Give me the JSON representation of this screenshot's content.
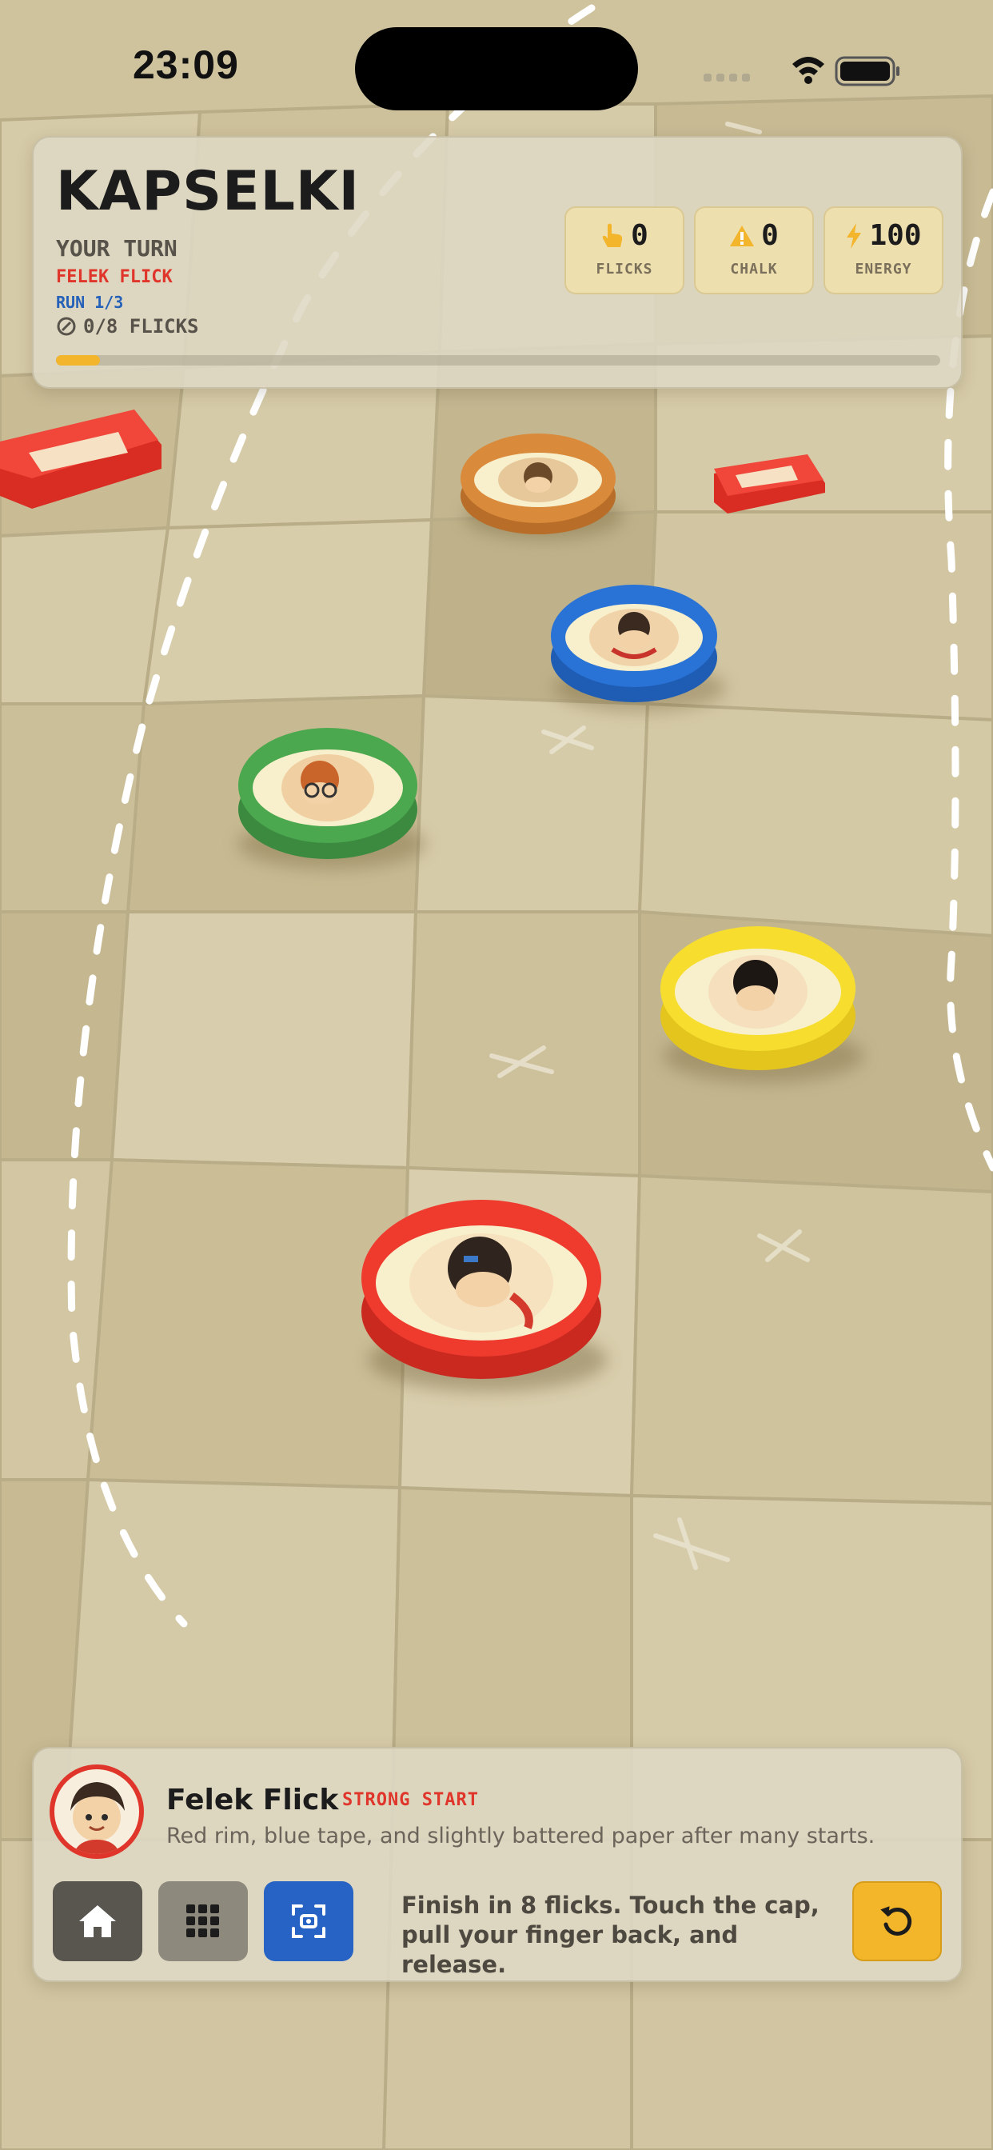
{
  "status_bar": {
    "time": "23:09"
  },
  "hud": {
    "title": "KAPSELKI",
    "turn_label": "YOUR TURN",
    "player_name": "FELEK FLICK",
    "run": "RUN 1/3",
    "flicks_progress_text": "0/8 FLICKS",
    "progress_fraction": 0.05,
    "stats": [
      {
        "value": "0",
        "label": "FLICKS",
        "icon": "pointer-hand-icon",
        "color": "#f2b52c"
      },
      {
        "value": "0",
        "label": "CHALK",
        "icon": "warning-icon",
        "color": "#f2b52c"
      },
      {
        "value": "100",
        "label": "ENERGY",
        "icon": "lightning-icon",
        "color": "#f2b52c"
      }
    ]
  },
  "board": {
    "caps": [
      {
        "name": "orange-cap",
        "color": "#d98a3a"
      },
      {
        "name": "blue-cap",
        "color": "#2a73d6"
      },
      {
        "name": "green-cap",
        "color": "#4ca84f"
      },
      {
        "name": "yellow-cap",
        "color": "#f7de2e"
      },
      {
        "name": "red-cap",
        "color": "#ef3a2e"
      }
    ]
  },
  "player_card": {
    "name": "Felek Flick",
    "tag": "STRONG START",
    "description": "Red rim, blue tape, and slightly battered paper after many starts.",
    "rim_color": "#e0352b"
  },
  "controls": {
    "home_icon": "home-icon",
    "grid_icon": "grid-menu-icon",
    "scan_icon": "camera-scan-icon",
    "restart_icon": "restart-icon"
  },
  "hint": {
    "line1": "Finish in 8 flicks. Touch the cap,",
    "line2": "pull your finger back, and release."
  },
  "colors": {
    "accent": "#f2b52c",
    "danger": "#e0352b",
    "primary": "#2663c4"
  }
}
